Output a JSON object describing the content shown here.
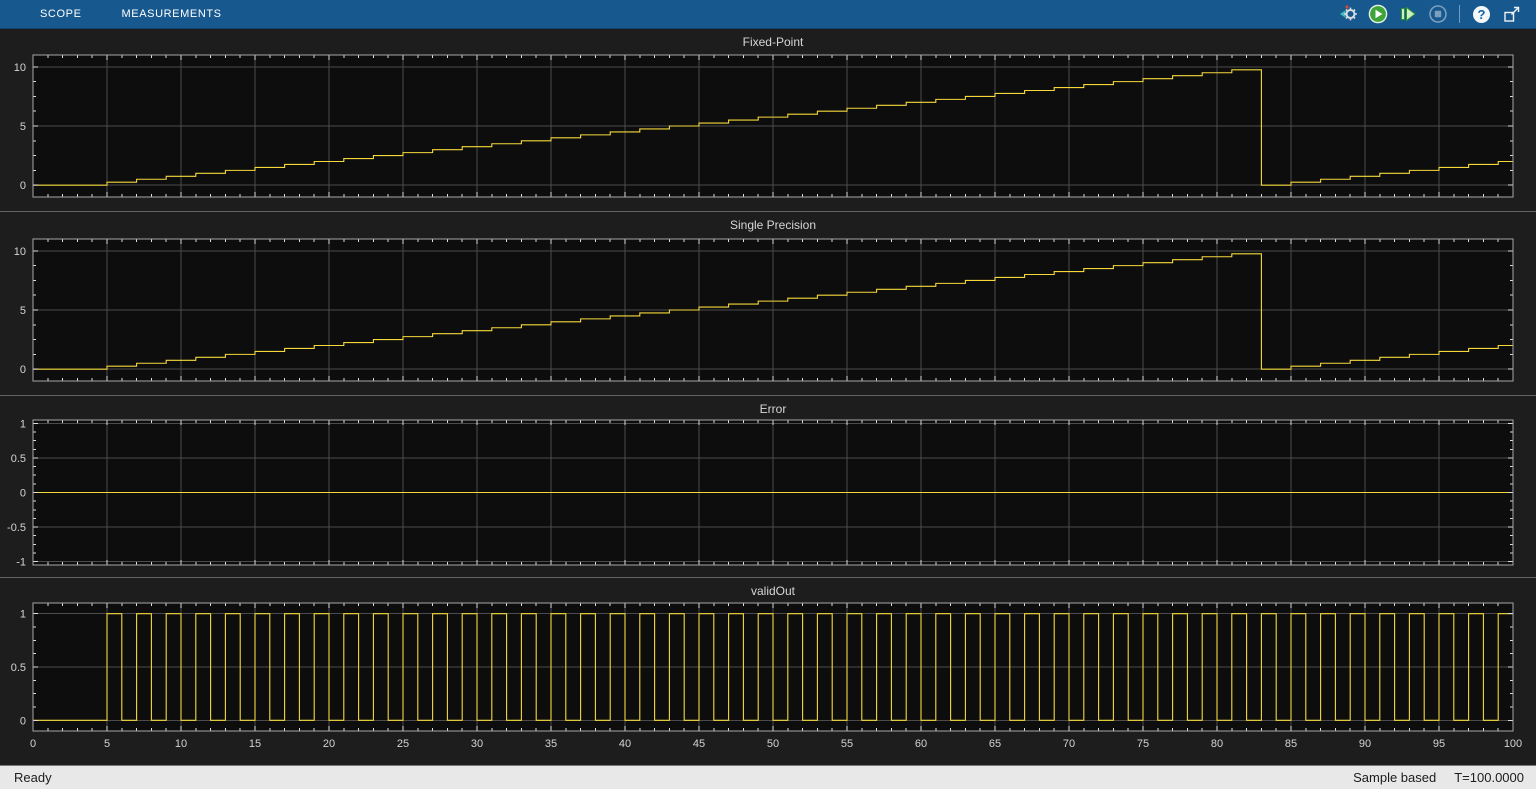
{
  "toolbar": {
    "tabs": [
      {
        "label": "SCOPE"
      },
      {
        "label": "MEASUREMENTS"
      }
    ],
    "buttons": {
      "settings": {
        "name": "simulation-settings"
      },
      "run": {
        "name": "run"
      },
      "step_forward": {
        "name": "step-forward"
      },
      "stop": {
        "name": "stop",
        "disabled": true
      },
      "help": {
        "name": "help",
        "glyph": "?"
      },
      "dock": {
        "name": "undock"
      }
    },
    "colors": {
      "background": "#17598f",
      "run_green": "#3fa53a",
      "step_green": "#cdeec4",
      "disabled_gray_blue": "#9db7cb"
    }
  },
  "status_bar": {
    "left": "Ready",
    "mode": "Sample based",
    "time": "T=100.0000"
  },
  "theme": {
    "panel_bg": "#1d1d1d",
    "plot_bg": "#0d0d0d",
    "grid": "#4c4c4c",
    "axis_border": "#a8a8a8",
    "tick": "#dedede",
    "tick_label": "#d4d4d4",
    "title": "#d6d6d6",
    "separator": "#646464",
    "signal_yellow": "#f5d93b"
  },
  "chart_data": [
    {
      "type": "line",
      "title": "Fixed-Point",
      "xlim": [
        0,
        100
      ],
      "ylim_display": [
        -1,
        11
      ],
      "x_major_step": 5,
      "x_minor_step": 1,
      "yticks": [
        0,
        5,
        10
      ],
      "y_minor_step": 1.25,
      "grid": true,
      "line_color": "#f5d93b",
      "series": {
        "kind": "steps",
        "name": "Fixed-Point",
        "start_value": 0,
        "end_time": 100,
        "changes": [
          [
            5,
            0.25
          ],
          [
            7,
            0.5
          ],
          [
            9,
            0.75
          ],
          [
            11,
            1
          ],
          [
            13,
            1.25
          ],
          [
            15,
            1.5
          ],
          [
            17,
            1.75
          ],
          [
            19,
            2
          ],
          [
            21,
            2.25
          ],
          [
            23,
            2.5
          ],
          [
            25,
            2.75
          ],
          [
            27,
            3
          ],
          [
            29,
            3.25
          ],
          [
            31,
            3.5
          ],
          [
            33,
            3.75
          ],
          [
            35,
            4
          ],
          [
            37,
            4.25
          ],
          [
            39,
            4.5
          ],
          [
            41,
            4.75
          ],
          [
            43,
            5
          ],
          [
            45,
            5.25
          ],
          [
            47,
            5.5
          ],
          [
            49,
            5.75
          ],
          [
            51,
            6
          ],
          [
            53,
            6.25
          ],
          [
            55,
            6.5
          ],
          [
            57,
            6.75
          ],
          [
            59,
            7
          ],
          [
            61,
            7.25
          ],
          [
            63,
            7.5
          ],
          [
            65,
            7.75
          ],
          [
            67,
            8
          ],
          [
            69,
            8.25
          ],
          [
            71,
            8.5
          ],
          [
            73,
            8.75
          ],
          [
            75,
            9
          ],
          [
            77,
            9.25
          ],
          [
            79,
            9.5
          ],
          [
            81,
            9.75
          ],
          [
            83,
            0
          ],
          [
            85,
            0.25
          ],
          [
            87,
            0.5
          ],
          [
            89,
            0.75
          ],
          [
            91,
            1
          ],
          [
            93,
            1.25
          ],
          [
            95,
            1.5
          ],
          [
            97,
            1.75
          ],
          [
            99,
            2
          ]
        ]
      }
    },
    {
      "type": "line",
      "title": "Single Precision",
      "xlim": [
        0,
        100
      ],
      "ylim_display": [
        -1,
        11
      ],
      "x_major_step": 5,
      "x_minor_step": 1,
      "yticks": [
        0,
        5,
        10
      ],
      "y_minor_step": 1.25,
      "grid": true,
      "line_color": "#f5d93b",
      "series": {
        "kind": "steps",
        "name": "Single Precision",
        "start_value": 0,
        "end_time": 100,
        "changes": [
          [
            5,
            0.25
          ],
          [
            7,
            0.5
          ],
          [
            9,
            0.75
          ],
          [
            11,
            1
          ],
          [
            13,
            1.25
          ],
          [
            15,
            1.5
          ],
          [
            17,
            1.75
          ],
          [
            19,
            2
          ],
          [
            21,
            2.25
          ],
          [
            23,
            2.5
          ],
          [
            25,
            2.75
          ],
          [
            27,
            3
          ],
          [
            29,
            3.25
          ],
          [
            31,
            3.5
          ],
          [
            33,
            3.75
          ],
          [
            35,
            4
          ],
          [
            37,
            4.25
          ],
          [
            39,
            4.5
          ],
          [
            41,
            4.75
          ],
          [
            43,
            5
          ],
          [
            45,
            5.25
          ],
          [
            47,
            5.5
          ],
          [
            49,
            5.75
          ],
          [
            51,
            6
          ],
          [
            53,
            6.25
          ],
          [
            55,
            6.5
          ],
          [
            57,
            6.75
          ],
          [
            59,
            7
          ],
          [
            61,
            7.25
          ],
          [
            63,
            7.5
          ],
          [
            65,
            7.75
          ],
          [
            67,
            8
          ],
          [
            69,
            8.25
          ],
          [
            71,
            8.5
          ],
          [
            73,
            8.75
          ],
          [
            75,
            9
          ],
          [
            77,
            9.25
          ],
          [
            79,
            9.5
          ],
          [
            81,
            9.75
          ],
          [
            83,
            0
          ],
          [
            85,
            0.25
          ],
          [
            87,
            0.5
          ],
          [
            89,
            0.75
          ],
          [
            91,
            1
          ],
          [
            93,
            1.25
          ],
          [
            95,
            1.5
          ],
          [
            97,
            1.75
          ],
          [
            99,
            2
          ]
        ]
      }
    },
    {
      "type": "line",
      "title": "Error",
      "xlim": [
        0,
        100
      ],
      "ylim_display": [
        -1.05,
        1.05
      ],
      "x_major_step": 5,
      "x_minor_step": 1,
      "yticks": [
        1,
        0.5,
        0,
        -0.5,
        -1
      ],
      "y_minor_step": 0.125,
      "grid": true,
      "line_color": "#f5d93b",
      "series": {
        "kind": "constant",
        "name": "Error",
        "value": 0,
        "end_time": 100
      }
    },
    {
      "type": "line",
      "title": "validOut",
      "xlim": [
        0,
        100
      ],
      "ylim_display": [
        -0.1,
        1.1
      ],
      "x_major_step": 5,
      "x_minor_step": 1,
      "yticks": [
        0,
        0.5,
        1
      ],
      "y_minor_step": 0.125,
      "grid": true,
      "x_tick_labels": [
        "0",
        "5",
        "10",
        "15",
        "20",
        "25",
        "30",
        "35",
        "40",
        "45",
        "50",
        "55",
        "60",
        "65",
        "70",
        "75",
        "80",
        "85",
        "90",
        "95",
        "100"
      ],
      "line_color": "#f5d93b",
      "series": {
        "kind": "square",
        "name": "validOut",
        "low_level": 0,
        "high_level": 1,
        "first_rise_time": 5,
        "high_duration": 1,
        "low_duration": 1,
        "end_time": 100
      }
    }
  ]
}
